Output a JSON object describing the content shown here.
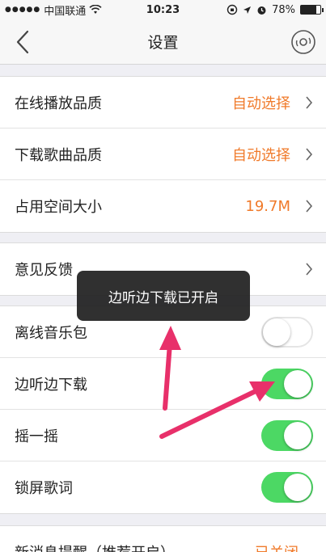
{
  "status_bar": {
    "carrier": "中国联通",
    "time": "10:23",
    "battery_percent": "78%",
    "battery_level": 0.78
  },
  "nav": {
    "title": "设置",
    "back_icon": "chevron-left-icon",
    "right_icon": "disc-icon"
  },
  "group1": [
    {
      "label": "在线播放品质",
      "value": "自动选择"
    },
    {
      "label": "下载歌曲品质",
      "value": "自动选择"
    },
    {
      "label": "占用空间大小",
      "value": "19.7M"
    }
  ],
  "group2": [
    {
      "label": "意见反馈"
    }
  ],
  "group3": [
    {
      "label": "离线音乐包",
      "on": false
    },
    {
      "label": "边听边下载",
      "on": true
    },
    {
      "label": "摇一摇",
      "on": true
    },
    {
      "label": "锁屏歌词",
      "on": true
    }
  ],
  "group4": [
    {
      "label": "新消息提醒（推荐开启）",
      "value": "已关闭"
    }
  ],
  "toast": {
    "text": "边听边下载已开启"
  },
  "colors": {
    "accent": "#f07a2a",
    "toggle_on": "#4cd864",
    "arrow": "#e8306a"
  }
}
